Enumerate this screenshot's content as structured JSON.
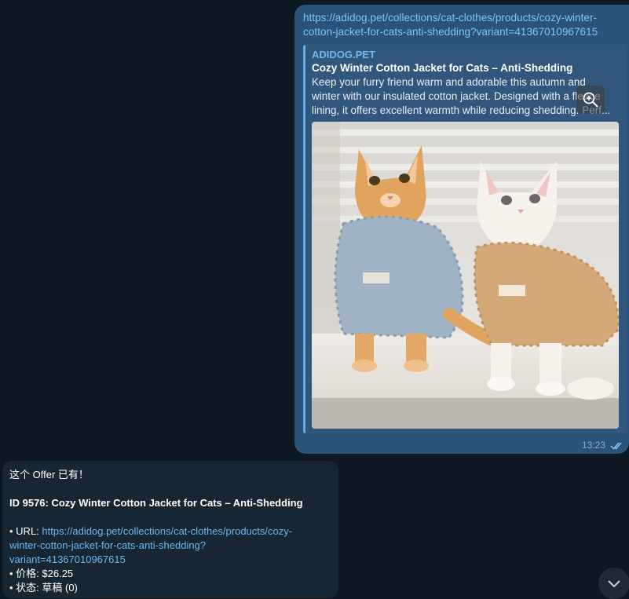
{
  "outgoing": {
    "url_line1": "https://adidog.pet/collections/cat-clothes/products/cozy-winter-",
    "url_line2": "cotton-jacket-for-cats-anti-shedding?variant=41367010967615",
    "preview": {
      "site": "ADIDOG.PET",
      "title": "Cozy Winter Cotton Jacket for Cats – Anti-Shedding",
      "desc_line1": "Keep your furry friend warm and adorable this autumn and",
      "desc_line2": "winter with our insulated cotton jacket. Designed with a fleece",
      "desc_line3": "lining, it offers excellent warmth while reducing shedding. Perf..."
    },
    "time": "13:23"
  },
  "incoming": {
    "line1": "这个 Offer 已有！",
    "id_title": "ID 9576: Cozy Winter Cotton Jacket for Cats – Anti-Shedding",
    "url_label": "• URL: ",
    "url_part1": "https://adidog.pet/collections/cat-clothes/products/cozy-",
    "url_part2": "winter-cotton-jacket-for-cats-anti-shedding?",
    "url_part3": "variant=41367010967615",
    "price": "• 价格: $26.25",
    "status": "• 状态: 草稿 (0)"
  },
  "icons": {
    "zoom": "zoom-in-icon",
    "read": "double-check-icon",
    "scroll": "chevron-down-icon"
  },
  "colors": {
    "background": "#0f1721",
    "outgoing_bubble": "#2b5278",
    "incoming_bubble": "#182533",
    "link": "#7cc3ff"
  }
}
